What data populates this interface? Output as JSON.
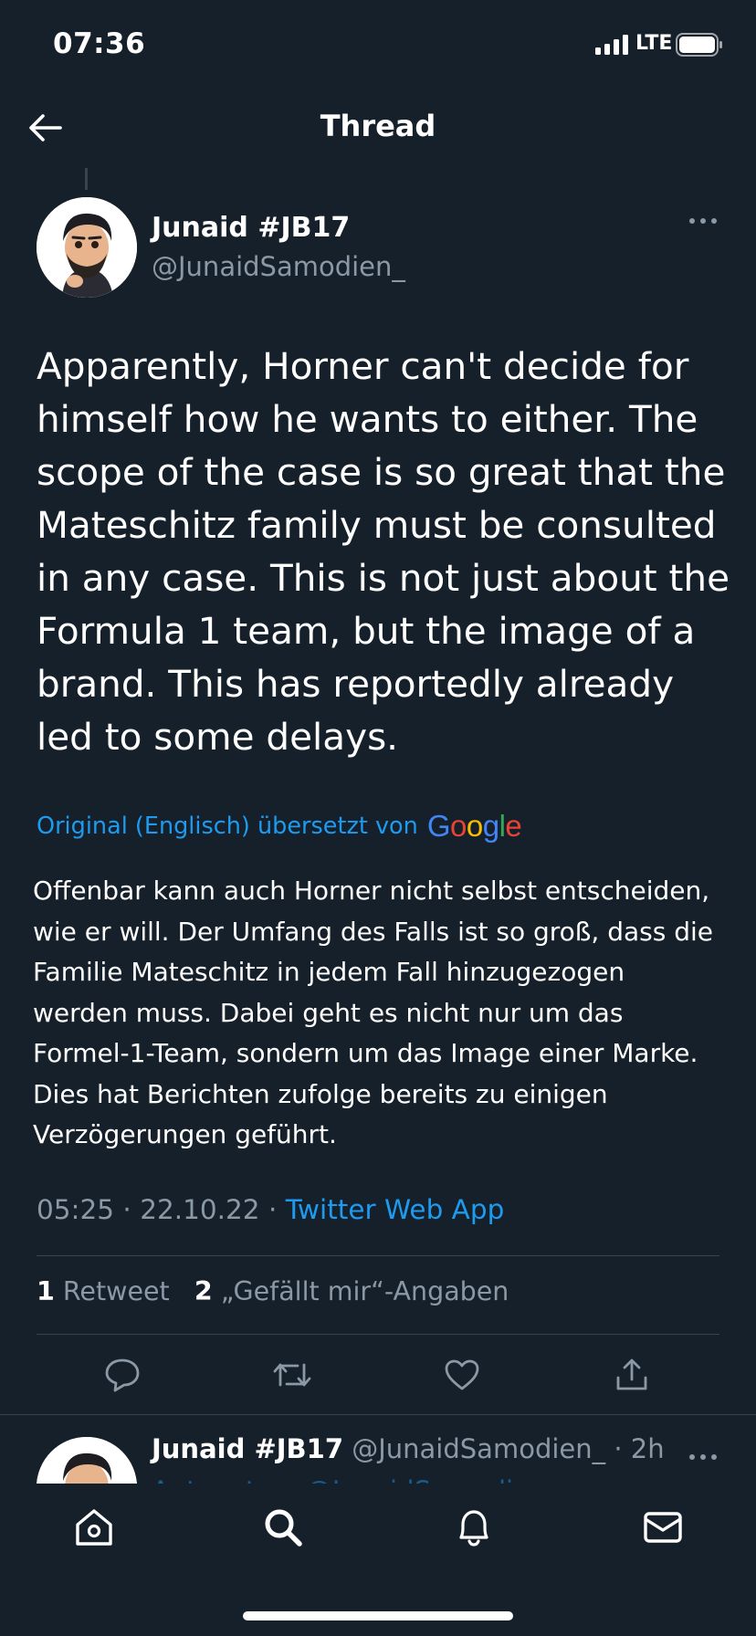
{
  "status_bar": {
    "time": "07:36",
    "network": "LTE"
  },
  "header": {
    "title": "Thread"
  },
  "tweet": {
    "author_name": "Junaid #JB17",
    "author_handle": "@JunaidSamodien_",
    "text": "Apparently, Horner can't decide for himself how he wants to either. The scope of the case is so great that the Mateschitz family must be consulted in any case. This is not just about the Formula 1 team, but the image of a brand. This has reportedly already led to some delays.",
    "translation_label": "Original (Englisch) übersetzt von",
    "translation_provider": "Google",
    "translated_text": "Offenbar kann auch Horner nicht selbst entscheiden, wie er will. Der Umfang des Falls ist so groß, dass die Familie Mateschitz in jedem Fall hinzugezogen werden muss. Dabei geht es nicht nur um das Formel-1-Team, sondern um das Image einer Marke. Dies hat Berichten zufolge bereits zu einigen Verzögerungen geführt.",
    "time": "05:25",
    "date": "22.10.22",
    "separator": "·",
    "source_app": "Twitter Web App",
    "retweet_count": "1",
    "retweet_label": "Retweet",
    "like_count": "2",
    "like_label": "„Gefällt mir“-Angaben"
  },
  "reply_preview": {
    "author_name": "Junaid #JB17",
    "author_handle": "@JunaidSamodien_",
    "time_ago": "· 2h",
    "sub_line": "Antwort an @JunaidSamodien_"
  },
  "icons": {
    "back": "arrow-left-icon",
    "more": "more-horizontal-icon",
    "reply": "comment-icon",
    "retweet": "retweet-icon",
    "like": "heart-icon",
    "share": "share-icon",
    "home": "home-icon",
    "search": "search-icon",
    "notifications": "bell-icon",
    "messages": "mail-icon"
  },
  "colors": {
    "background": "#15202b",
    "accent": "#1d9bf0",
    "secondary_text": "#8b98a5",
    "divider": "#38444d"
  }
}
